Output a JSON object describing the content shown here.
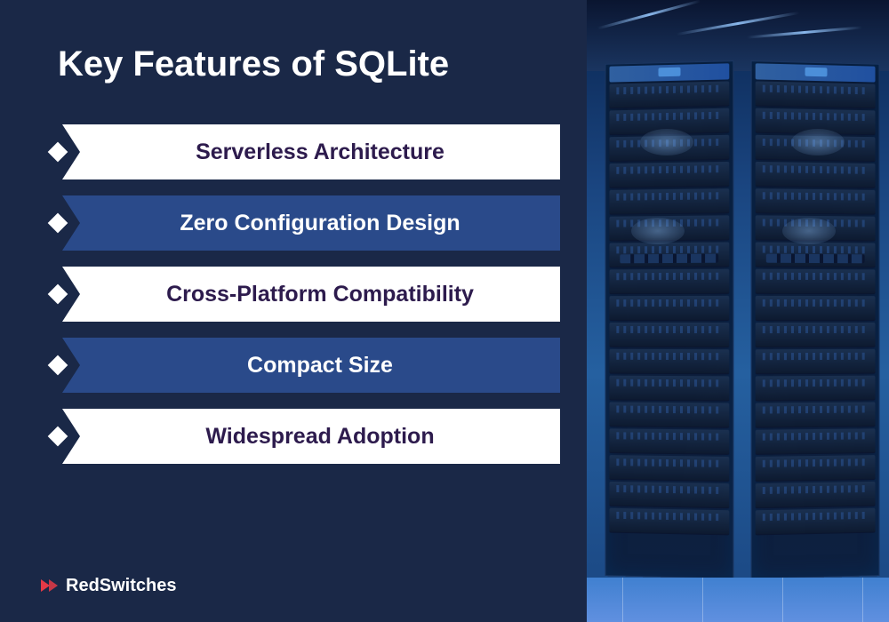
{
  "title": "Key Features of SQLite",
  "features": [
    {
      "label": "Serverless Architecture",
      "variant": "white"
    },
    {
      "label": "Zero Configuration Design",
      "variant": "blue"
    },
    {
      "label": "Cross-Platform Compatibility",
      "variant": "white"
    },
    {
      "label": "Compact Size",
      "variant": "blue"
    },
    {
      "label": "Widespread Adoption",
      "variant": "white"
    }
  ],
  "brand": {
    "name": "RedSwitches"
  }
}
